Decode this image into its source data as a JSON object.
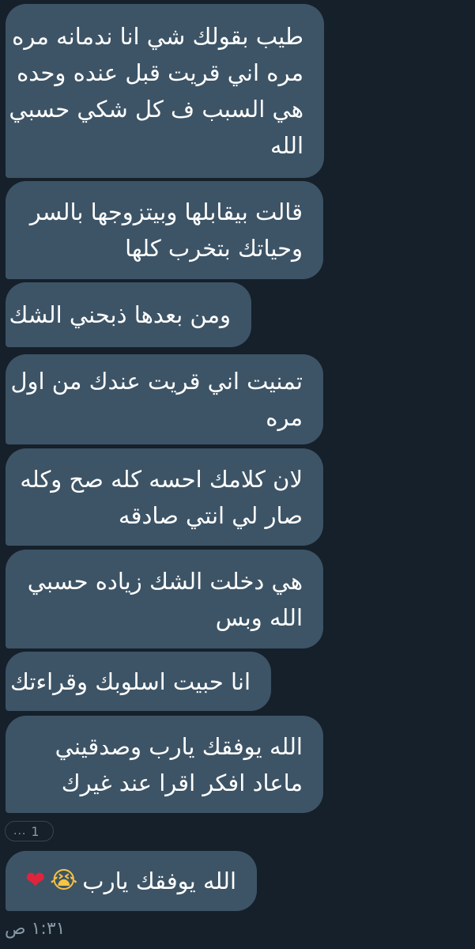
{
  "messages": [
    {
      "lines": [
        "طيب بقولك شي انا ندمانه مره",
        "مره اني قريت قبل عنده وحده",
        "هي السبب ف كل شكي حسبي",
        "الله"
      ]
    },
    {
      "lines": [
        "قالت بيقابلها وبيتزوجها بالسر",
        "وحياتك بتخرب كلها"
      ]
    },
    {
      "lines": [
        "ومن بعدها ذبحني الشك"
      ]
    },
    {
      "lines": [
        "تمنيت اني قريت عندك من اول",
        "مره"
      ]
    },
    {
      "lines": [
        "لان كلامك احسه كله صح وكله",
        "صار لي انتي صادقه"
      ]
    },
    {
      "lines": [
        "هي دخلت الشك زياده حسبي",
        "الله وبس"
      ]
    },
    {
      "lines": [
        "انا حبيت اسلوبك وقراءتك"
      ]
    },
    {
      "lines": [
        "الله يوفقك يارب وصدقيني",
        "ماعاد افكر اقرا عند غيرك"
      ]
    }
  ],
  "reaction": {
    "count": "1",
    "more": "..."
  },
  "reply": {
    "text": "الله يوفقك يارب",
    "emojis": [
      "😭",
      "❤"
    ]
  },
  "timestamp": "١:٣١ ص",
  "colors": {
    "background": "#15202b",
    "bubble": "#3d5466",
    "muted": "#8899a6",
    "heart": "#e0243c"
  }
}
